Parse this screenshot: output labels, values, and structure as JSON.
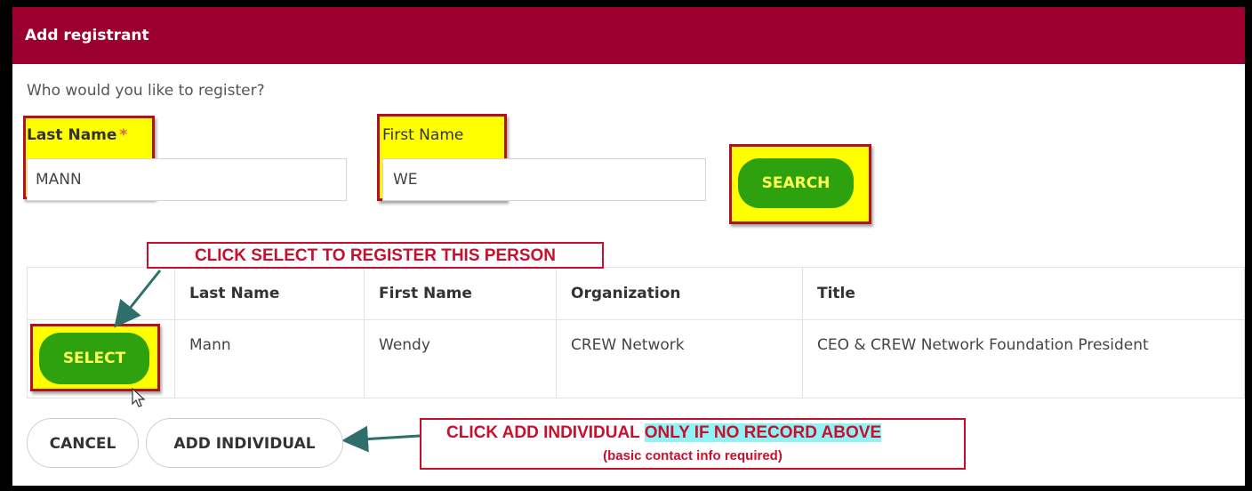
{
  "dialog": {
    "title": "Add registrant",
    "prompt": "Who would you like to register?"
  },
  "search": {
    "last_name_label": "Last Name",
    "required_marker": "*",
    "last_name_value": "MANN",
    "first_name_label": "First Name",
    "first_name_value": "WE",
    "search_button": "SEARCH"
  },
  "results": {
    "columns": [
      "",
      "Last Name",
      "First Name",
      "Organization",
      "Title"
    ],
    "rows": [
      {
        "select_label": "SELECT",
        "last_name": "Mann",
        "first_name": "Wendy",
        "organization": "CREW Network",
        "title": "CEO & CREW Network Foundation President"
      }
    ]
  },
  "footer": {
    "cancel_label": "CANCEL",
    "add_individual_label": "ADD INDIVIDUAL"
  },
  "annotations": {
    "select_callout": "CLICK SELECT TO REGISTER THIS PERSON",
    "add_callout_prefix": "CLICK ADD INDIVIDUAL",
    "add_callout_highlight": "ONLY IF NO RECORD ABOVE",
    "add_callout_sub": "(basic contact info required)"
  },
  "colors": {
    "header": "#9b0030",
    "button_green": "#2ea10f",
    "button_text": "#ffff55",
    "highlight": "#ffff00",
    "callout_red": "#c8102e",
    "arrow": "#2f6f6a"
  }
}
